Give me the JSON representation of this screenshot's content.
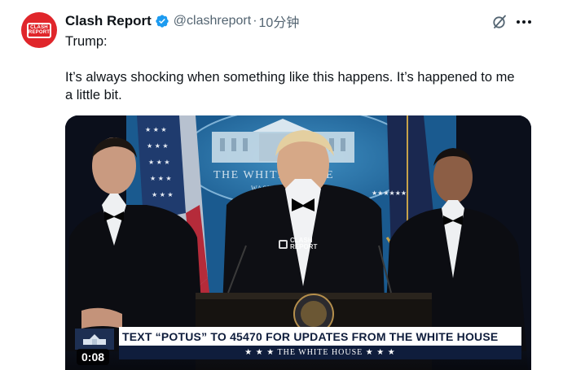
{
  "author": {
    "display_name": "Clash Report",
    "handle": "@clashreport",
    "separator": "·",
    "timestamp": "10分钟",
    "avatar_line1": "CLASH",
    "avatar_line2": "REPORT",
    "verified_icon": "verified-badge-icon",
    "verified_color": "#1d9bf0",
    "avatar_color": "#e0262b"
  },
  "actions": {
    "grok_icon": "grok-icon",
    "more_icon": "more-icon"
  },
  "tweet": {
    "line1": "Trump:",
    "line2": "It’s always shocking when something like this happens. It’s happened to me",
    "line3": "a little bit."
  },
  "video": {
    "duration": "0:08",
    "watermark_line1": "CLASH",
    "watermark_line2": "REPORT",
    "backdrop_text": "THE WHITE HOUSE",
    "backdrop_subtext": "WASHINGTON",
    "lower_third_headline": "TEXT “POTUS” TO 45470 FOR UPDATES FROM THE WHITE HOUSE",
    "lower_third_sub": "★ ★ ★  THE WHITE HOUSE  ★ ★ ★"
  }
}
